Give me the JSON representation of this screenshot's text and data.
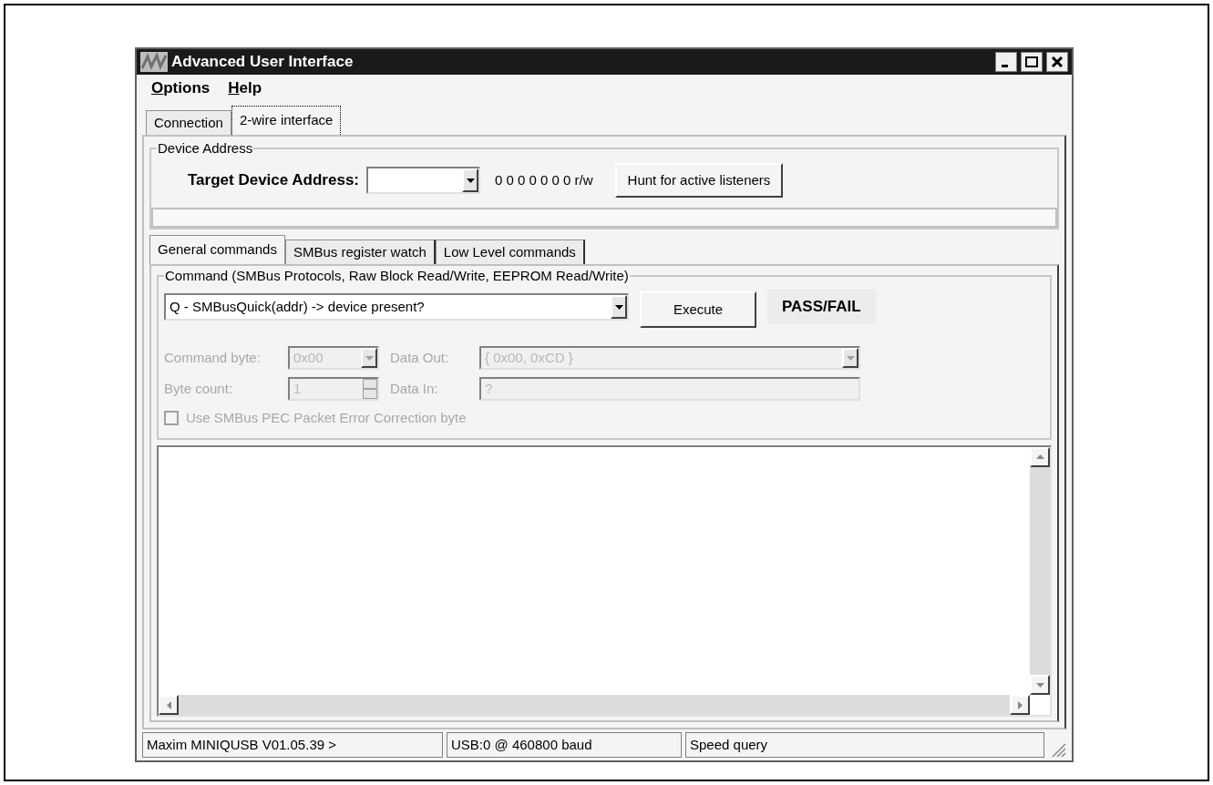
{
  "window": {
    "title": "Advanced User Interface"
  },
  "menu": [
    {
      "mnemonic": "O",
      "rest": "ptions"
    },
    {
      "mnemonic": "H",
      "rest": "elp"
    }
  ],
  "tabs": [
    {
      "label": "Connection",
      "selected": false
    },
    {
      "label": "2-wire interface",
      "selected": true
    }
  ],
  "device_address": {
    "legend": "Device Address",
    "label": "Target Device Address:",
    "address_bits": "0 0 0 0 0 0 0 r/w",
    "hunt_button": "Hunt for active listeners"
  },
  "sub_tabs": [
    {
      "label": "General commands",
      "selected": true
    },
    {
      "label": "SMBus register watch",
      "selected": false
    },
    {
      "label": "Low Level commands",
      "selected": false
    }
  ],
  "command": {
    "legend": "Command (SMBus Protocols, Raw Block Read/Write, EEPROM Read/Write)",
    "value": "Q - SMBusQuick(addr) -> device present?",
    "execute_button": "Execute",
    "result": "PASS/FAIL",
    "command_byte": {
      "label": "Command byte:",
      "value": "0x00",
      "disabled": true
    },
    "data_out": {
      "label": "Data Out:",
      "value": "{ 0x00, 0xCD }",
      "disabled": true
    },
    "byte_count": {
      "label": "Byte count:",
      "value": "1",
      "disabled": true
    },
    "data_in": {
      "label": "Data In:",
      "value": "?",
      "disabled": true
    },
    "pec": {
      "label": "Use SMBus PEC Packet Error Correction byte",
      "checked": false,
      "disabled": true
    }
  },
  "status_bar": [
    "Maxim MINIQUSB V01.05.39 >",
    "USB:0 @ 460800 baud",
    "Speed query"
  ]
}
